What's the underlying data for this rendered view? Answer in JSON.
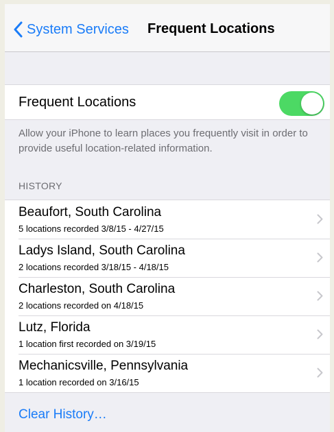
{
  "navbar": {
    "back_label": "System Services",
    "title": "Frequent Locations"
  },
  "frequent_locations": {
    "label": "Frequent Locations",
    "enabled": true,
    "description": "Allow your iPhone to learn places you frequently visit in order to provide useful location-related information."
  },
  "history": {
    "header": "HISTORY",
    "items": [
      {
        "title": "Beaufort, South Carolina",
        "subtitle": "5 locations recorded 3/8/15 - 4/27/15"
      },
      {
        "title": "Ladys Island, South Carolina",
        "subtitle": "2 locations recorded 3/18/15 - 4/18/15"
      },
      {
        "title": "Charleston, South Carolina",
        "subtitle": "2 locations recorded on 4/18/15"
      },
      {
        "title": "Lutz, Florida",
        "subtitle": "1 location first recorded on 3/19/15"
      },
      {
        "title": "Mechanicsville, Pennsylvania",
        "subtitle": "1 location recorded on 3/16/15"
      }
    ],
    "clear_label": "Clear History…"
  },
  "colors": {
    "accent": "#1a7cf8",
    "toggle_on": "#4cd964",
    "group_background": "#efeff4"
  },
  "icons": {
    "back": "chevron-left-icon",
    "row": "chevron-right-icon"
  }
}
